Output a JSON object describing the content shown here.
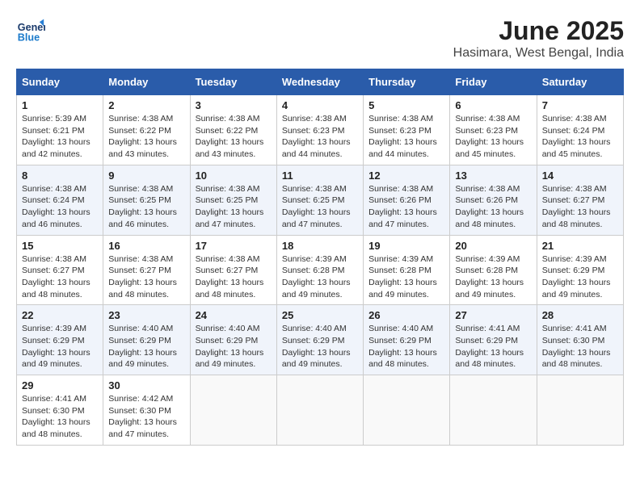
{
  "header": {
    "logo_line1": "General",
    "logo_line2": "Blue",
    "month_year": "June 2025",
    "location": "Hasimara, West Bengal, India"
  },
  "weekdays": [
    "Sunday",
    "Monday",
    "Tuesday",
    "Wednesday",
    "Thursday",
    "Friday",
    "Saturday"
  ],
  "weeks": [
    [
      {
        "day": "1",
        "sunrise": "5:39 AM",
        "sunset": "6:21 PM",
        "daylight": "13 hours and 42 minutes."
      },
      {
        "day": "2",
        "sunrise": "4:38 AM",
        "sunset": "6:22 PM",
        "daylight": "13 hours and 43 minutes."
      },
      {
        "day": "3",
        "sunrise": "4:38 AM",
        "sunset": "6:22 PM",
        "daylight": "13 hours and 43 minutes."
      },
      {
        "day": "4",
        "sunrise": "4:38 AM",
        "sunset": "6:23 PM",
        "daylight": "13 hours and 44 minutes."
      },
      {
        "day": "5",
        "sunrise": "4:38 AM",
        "sunset": "6:23 PM",
        "daylight": "13 hours and 44 minutes."
      },
      {
        "day": "6",
        "sunrise": "4:38 AM",
        "sunset": "6:23 PM",
        "daylight": "13 hours and 45 minutes."
      },
      {
        "day": "7",
        "sunrise": "4:38 AM",
        "sunset": "6:24 PM",
        "daylight": "13 hours and 45 minutes."
      }
    ],
    [
      {
        "day": "8",
        "sunrise": "4:38 AM",
        "sunset": "6:24 PM",
        "daylight": "13 hours and 46 minutes."
      },
      {
        "day": "9",
        "sunrise": "4:38 AM",
        "sunset": "6:25 PM",
        "daylight": "13 hours and 46 minutes."
      },
      {
        "day": "10",
        "sunrise": "4:38 AM",
        "sunset": "6:25 PM",
        "daylight": "13 hours and 47 minutes."
      },
      {
        "day": "11",
        "sunrise": "4:38 AM",
        "sunset": "6:25 PM",
        "daylight": "13 hours and 47 minutes."
      },
      {
        "day": "12",
        "sunrise": "4:38 AM",
        "sunset": "6:26 PM",
        "daylight": "13 hours and 47 minutes."
      },
      {
        "day": "13",
        "sunrise": "4:38 AM",
        "sunset": "6:26 PM",
        "daylight": "13 hours and 48 minutes."
      },
      {
        "day": "14",
        "sunrise": "4:38 AM",
        "sunset": "6:27 PM",
        "daylight": "13 hours and 48 minutes."
      }
    ],
    [
      {
        "day": "15",
        "sunrise": "4:38 AM",
        "sunset": "6:27 PM",
        "daylight": "13 hours and 48 minutes."
      },
      {
        "day": "16",
        "sunrise": "4:38 AM",
        "sunset": "6:27 PM",
        "daylight": "13 hours and 48 minutes."
      },
      {
        "day": "17",
        "sunrise": "4:38 AM",
        "sunset": "6:27 PM",
        "daylight": "13 hours and 48 minutes."
      },
      {
        "day": "18",
        "sunrise": "4:39 AM",
        "sunset": "6:28 PM",
        "daylight": "13 hours and 49 minutes."
      },
      {
        "day": "19",
        "sunrise": "4:39 AM",
        "sunset": "6:28 PM",
        "daylight": "13 hours and 49 minutes."
      },
      {
        "day": "20",
        "sunrise": "4:39 AM",
        "sunset": "6:28 PM",
        "daylight": "13 hours and 49 minutes."
      },
      {
        "day": "21",
        "sunrise": "4:39 AM",
        "sunset": "6:29 PM",
        "daylight": "13 hours and 49 minutes."
      }
    ],
    [
      {
        "day": "22",
        "sunrise": "4:39 AM",
        "sunset": "6:29 PM",
        "daylight": "13 hours and 49 minutes."
      },
      {
        "day": "23",
        "sunrise": "4:40 AM",
        "sunset": "6:29 PM",
        "daylight": "13 hours and 49 minutes."
      },
      {
        "day": "24",
        "sunrise": "4:40 AM",
        "sunset": "6:29 PM",
        "daylight": "13 hours and 49 minutes."
      },
      {
        "day": "25",
        "sunrise": "4:40 AM",
        "sunset": "6:29 PM",
        "daylight": "13 hours and 49 minutes."
      },
      {
        "day": "26",
        "sunrise": "4:40 AM",
        "sunset": "6:29 PM",
        "daylight": "13 hours and 48 minutes."
      },
      {
        "day": "27",
        "sunrise": "4:41 AM",
        "sunset": "6:29 PM",
        "daylight": "13 hours and 48 minutes."
      },
      {
        "day": "28",
        "sunrise": "4:41 AM",
        "sunset": "6:30 PM",
        "daylight": "13 hours and 48 minutes."
      }
    ],
    [
      {
        "day": "29",
        "sunrise": "4:41 AM",
        "sunset": "6:30 PM",
        "daylight": "13 hours and 48 minutes."
      },
      {
        "day": "30",
        "sunrise": "4:42 AM",
        "sunset": "6:30 PM",
        "daylight": "13 hours and 47 minutes."
      },
      null,
      null,
      null,
      null,
      null
    ]
  ]
}
